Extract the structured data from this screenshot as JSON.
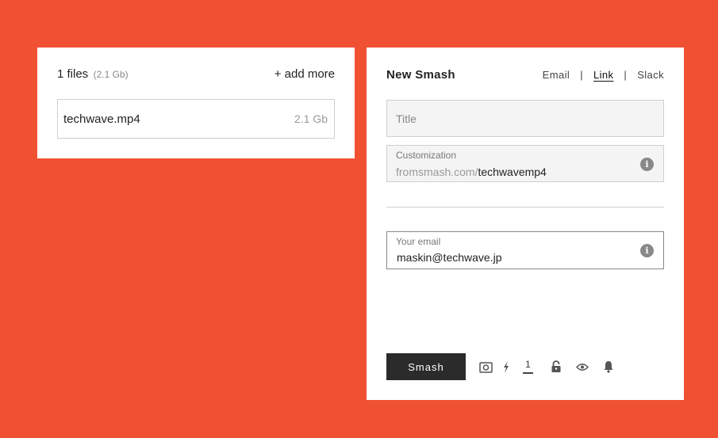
{
  "files": {
    "count_label": "1 files",
    "total_size": "(2.1 Gb)",
    "add_more_label": "+ add more",
    "items": [
      {
        "name": "techwave.mp4",
        "size": "2.1 Gb"
      }
    ]
  },
  "smash": {
    "title": "New Smash",
    "tabs": [
      {
        "label": "Email",
        "active": false
      },
      {
        "label": "Link",
        "active": true
      },
      {
        "label": "Slack",
        "active": false
      }
    ],
    "tab_separator": "|",
    "title_field": {
      "placeholder": "Title",
      "value": ""
    },
    "customization": {
      "label": "Customization",
      "prefix": "fromsmash.com/",
      "slug": "techwavemp4",
      "info_icon": "i"
    },
    "email": {
      "label": "Your email",
      "value": "maskin@techwave.jp",
      "info_icon": "i"
    },
    "button_label": "Smash",
    "options": {
      "icons": [
        "camera-icon",
        "lightning-icon",
        "lock-icon",
        "eye-icon",
        "bell-icon"
      ],
      "download_count": "1"
    }
  },
  "colors": {
    "background": "#f05133",
    "button": "#2b2b2b"
  }
}
